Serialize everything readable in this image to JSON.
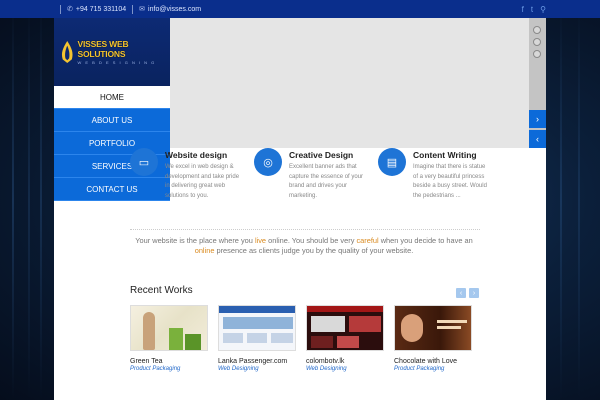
{
  "topbar": {
    "phone": "+94 715 331104",
    "email": "info@visses.com",
    "social": [
      "facebook-icon",
      "twitter-icon",
      "search-icon"
    ]
  },
  "logo": {
    "title": "VISSES WEB SOLUTIONS",
    "subtitle": "W E B  D E S I G N I N G"
  },
  "nav": {
    "items": [
      {
        "label": "HOME",
        "active": true
      },
      {
        "label": "ABOUT US"
      },
      {
        "label": "PORTFOLIO"
      },
      {
        "label": "SERVICES"
      },
      {
        "label": "CONTACT US"
      }
    ]
  },
  "slider": {
    "next": "›",
    "prev": "‹"
  },
  "features": [
    {
      "title": "Website design",
      "desc": "We excel in web design & development and take pride in delivering great web solutions to you.",
      "icon": "monitor-icon"
    },
    {
      "title": "Creative Design",
      "desc": "Excellent banner ads that capture the essence of your brand and drives your marketing.",
      "icon": "weibo-icon"
    },
    {
      "title": "Content Writing",
      "desc": "Imagine that there is statue of a very beautiful princess beside a busy street. Would the pedestrians ...",
      "icon": "book-icon"
    }
  ],
  "tagline": {
    "p1": "Your website is the place where you ",
    "h1": "live",
    "p2": " online. You should be very ",
    "h2": "careful",
    "p3": "  when you decide to have an ",
    "h3": "online",
    "p4": " presence as clients judge you by the quality of your website."
  },
  "recent_works": {
    "title": "Recent Works",
    "prev": "‹",
    "next": "›",
    "items": [
      {
        "name": "Green Tea",
        "category": "Product Packaging"
      },
      {
        "name": "Lanka Passenger.com",
        "category": "Web Designing"
      },
      {
        "name": "colombotv.lk",
        "category": "Web Designing"
      },
      {
        "name": "Chocolate with Love",
        "category": "Product Packaging"
      }
    ]
  },
  "colors": {
    "topbar": "#0a2e8c",
    "nav": "#0c6ad9",
    "accent": "#1e74d6",
    "highlight": "#d98a1f"
  }
}
